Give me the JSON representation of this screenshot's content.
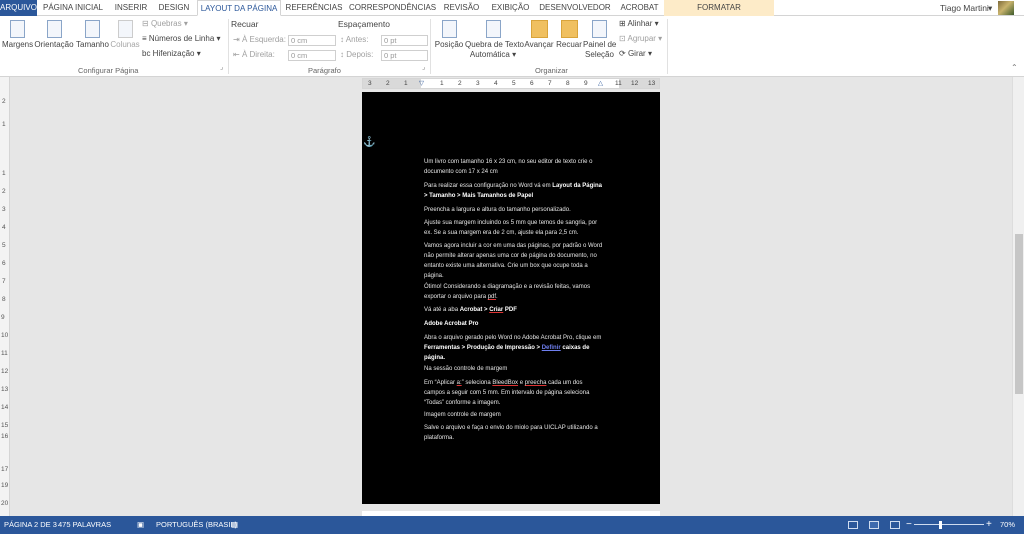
{
  "tabs": [
    "ARQUIVO",
    "PÁGINA INICIAL",
    "INSERIR",
    "DESIGN",
    "LAYOUT DA PÁGINA",
    "REFERÊNCIAS",
    "CORRESPONDÊNCIAS",
    "REVISÃO",
    "EXIBIÇÃO",
    "DESENVOLVEDOR",
    "ACROBAT",
    "FORMATAR"
  ],
  "active_tab": "LAYOUT DA PÁGINA",
  "user": {
    "name": "Tiago Martini",
    "caret": "▾"
  },
  "ribbon": {
    "configurar": {
      "margens": "Margens",
      "orientacao": "Orientação",
      "tamanho": "Tamanho",
      "colunas": "Colunas",
      "quebras": "Quebras",
      "numeros_linha": "Números de Linha",
      "hifenizacao": "Hifenização",
      "label": "Configurar Página"
    },
    "paragrafo": {
      "recuar": "Recuar",
      "esquerda": "À Esquerda:",
      "direita": "À Direita:",
      "esquerda_val": "0 cm",
      "direita_val": "0 cm",
      "espacamento": "Espaçamento",
      "antes": "Antes:",
      "depois": "Depois:",
      "antes_val": "0 pt",
      "depois_val": "0 pt",
      "label": "Parágrafo"
    },
    "organizar": {
      "posicao": "Posição",
      "quebra_texto_1": "Quebra de Texto",
      "quebra_texto_2": "Automática",
      "avancar": "Avançar",
      "recuar": "Recuar",
      "painel_1": "Painel de",
      "painel_2": "Seleção",
      "alinhar": "Alinhar",
      "agrupar": "Agrupar",
      "girar": "Girar",
      "label": "Organizar"
    }
  },
  "ruler": {
    "horizontal": [
      "3",
      "2",
      "1",
      "1",
      "2",
      "3",
      "4",
      "5",
      "6",
      "7",
      "8",
      "9",
      "11",
      "12",
      "13"
    ],
    "vertical": [
      "2",
      "1",
      "1",
      "2",
      "3",
      "4",
      "5",
      "6",
      "7",
      "8",
      "9",
      "10",
      "11",
      "12",
      "13",
      "14",
      "15",
      "16",
      "17",
      "19",
      "20"
    ]
  },
  "document": {
    "p1": "Um livro com tamanho 16 x 23 cm, no seu editor de texto crie o documento com 17 x 24 cm",
    "p2_a": " Para realizar essa configuração no Word vá em ",
    "p2_b": "Layout da Página > Tamanho > Mais Tamanhos de Papel",
    "p3": "Preencha a largura e altura do tamanho personalizado.",
    "p4": "Ajuste sua margem incluindo os 5 mm que temos de sangria, por ex. Se a sua margem era de 2 cm, ajuste ela para 2,5 cm.",
    "p5": "Vamos agora incluir a cor em uma das páginas, por padrão o Word não permite alterar apenas uma cor de página do documento, no entanto existe uma alternativa. Crie um box que ocupe toda a página.",
    "p6_a": "Ótimo! Considerando a diagramação e a revisão feitas, vamos exportar o arquivo para ",
    "p6_b": "pdf",
    "p6_c": ".",
    "p7_a": "Vá até a aba ",
    "p7_b": "Acrobat > ",
    "p7_c": "Criar",
    "p7_d": " PDF",
    "p8": "Adobe Acrobat Pro",
    "p9_a": "Abra o arquivo gerado pelo Word no Adobe Acrobat Pro, clique em ",
    "p9_b": "Ferramentas > Produção de Impressão > ",
    "p9_c": "Definir",
    "p9_d": " caixas de página.",
    "p10": "Na sessão controle de margem",
    "p11_a": "Em “Aplicar ",
    "p11_b": "a:",
    "p11_c": "” seleciona ",
    "p11_d": "BleedBox",
    "p11_e": " e ",
    "p11_f": "preecha",
    "p11_g": " cada um dos campos a seguir com 5 mm. Em intervalo de página seleciona “Todas” conforme a imagem.",
    "p12": "Imagem controle de margem",
    "p13": "Salve o arquivo e faça o envio do miolo para UICLAP utilizando a plataforma."
  },
  "status": {
    "page": "PÁGINA 2 DE 3",
    "words": "475 PALAVRAS",
    "lang": "PORTUGUÊS (BRASIL)",
    "minus": "−",
    "plus": "+",
    "zoom": "70%"
  },
  "colors": {
    "accent": "#2b579a",
    "format_tab": "#fdebc8"
  }
}
